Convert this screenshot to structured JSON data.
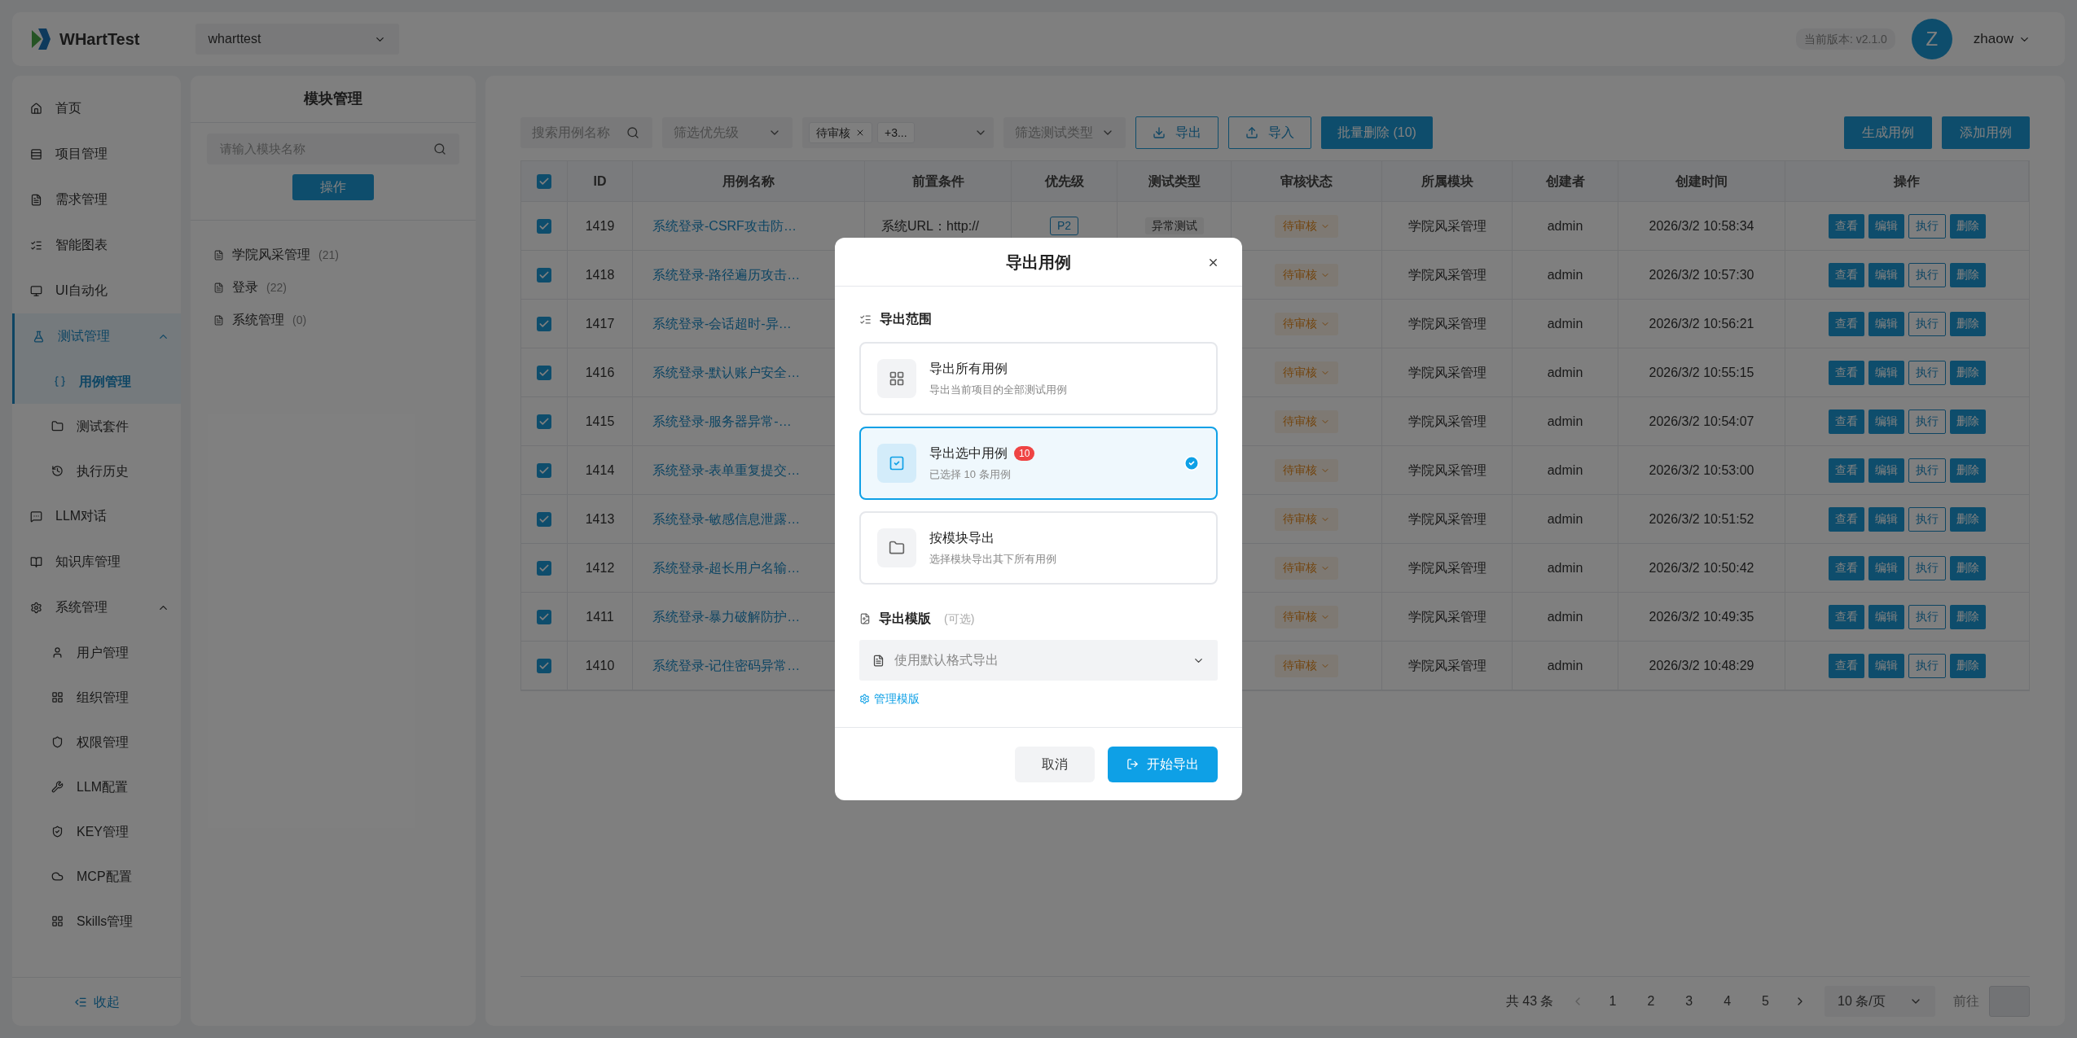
{
  "header": {
    "logo_text": "WHartTest",
    "project": "wharttest",
    "version": "当前版本: v2.1.0",
    "avatar_letter": "Z",
    "user": "zhaow"
  },
  "sidebar": {
    "items": [
      {
        "label": "首页",
        "selected": false
      },
      {
        "label": "项目管理",
        "selected": false
      },
      {
        "label": "需求管理",
        "selected": false
      },
      {
        "label": "智能图表",
        "selected": false
      },
      {
        "label": "UI自动化",
        "selected": false
      },
      {
        "label": "测试管理",
        "selected": true,
        "expanded": true,
        "children": [
          {
            "label": "用例管理",
            "selected": true
          },
          {
            "label": "测试套件",
            "selected": false
          },
          {
            "label": "执行历史",
            "selected": false
          }
        ]
      },
      {
        "label": "LLM对话",
        "selected": false
      },
      {
        "label": "知识库管理",
        "selected": false
      },
      {
        "label": "系统管理",
        "selected": false,
        "expanded": true,
        "children": [
          {
            "label": "用户管理",
            "selected": false
          },
          {
            "label": "组织管理",
            "selected": false
          },
          {
            "label": "权限管理",
            "selected": false
          },
          {
            "label": "LLM配置",
            "selected": false
          },
          {
            "label": "KEY管理",
            "selected": false
          },
          {
            "label": "MCP配置",
            "selected": false
          },
          {
            "label": "Skills管理",
            "selected": false
          }
        ]
      }
    ],
    "collapse_label": "收起"
  },
  "module_panel": {
    "title": "模块管理",
    "search_placeholder": "请输入模块名称",
    "action_button": "操作",
    "tree": [
      {
        "name": "学院风采管理",
        "count": "(21)"
      },
      {
        "name": "登录",
        "count": "(22)"
      },
      {
        "name": "系统管理",
        "count": "(0)"
      }
    ]
  },
  "toolbar": {
    "search_placeholder": "搜索用例名称",
    "priority_placeholder": "筛选优先级",
    "status_tags": [
      "待审核"
    ],
    "status_more": "+3...",
    "type_placeholder": "筛选测试类型",
    "buttons": [
      {
        "label": "导出",
        "kind": "download"
      },
      {
        "label": "导入",
        "kind": "upload"
      },
      {
        "label": "批量删除 (10)",
        "kind": "primary"
      }
    ],
    "right_buttons": [
      "生成用例",
      "添加用例"
    ]
  },
  "table": {
    "all_checked": true,
    "columns": [
      "ID",
      "用例名称",
      "前置条件",
      "优先级",
      "测试类型",
      "审核状态",
      "所属模块",
      "创建者",
      "创建时间",
      "操作"
    ],
    "rows": [
      {
        "checked": true,
        "id": "1419",
        "name": "系统登录-CSRF攻击防…",
        "precondition": "系统URL：http://",
        "priority": "P2",
        "test_type": "异常测试",
        "status": "待审核",
        "module": "学院风采管理",
        "creator": "admin",
        "created": "2026/3/2 10:58:34",
        "actions": [
          {
            "label": "查看",
            "kind": "solid"
          },
          {
            "label": "编辑",
            "kind": "solid"
          },
          {
            "label": "执行",
            "kind": "outline"
          },
          {
            "label": "删除",
            "kind": "solid"
          }
        ]
      },
      {
        "checked": true,
        "id": "1418",
        "name": "系统登录-路径遍历攻击…",
        "status": "待审核",
        "module": "学院风采管理",
        "creator": "admin",
        "created": "2026/3/2 10:57:30",
        "actions": [
          {
            "label": "查看",
            "kind": "solid"
          },
          {
            "label": "编辑",
            "kind": "solid"
          },
          {
            "label": "执行",
            "kind": "outline"
          },
          {
            "label": "删除",
            "kind": "solid"
          }
        ]
      },
      {
        "checked": true,
        "id": "1417",
        "name": "系统登录-会话超时-异…",
        "status": "待审核",
        "module": "学院风采管理",
        "creator": "admin",
        "created": "2026/3/2 10:56:21",
        "actions": [
          {
            "label": "查看",
            "kind": "solid"
          },
          {
            "label": "编辑",
            "kind": "solid"
          },
          {
            "label": "执行",
            "kind": "outline"
          },
          {
            "label": "删除",
            "kind": "solid"
          }
        ]
      },
      {
        "checked": true,
        "id": "1416",
        "name": "系统登录-默认账户安全…",
        "status": "待审核",
        "module": "学院风采管理",
        "creator": "admin",
        "created": "2026/3/2 10:55:15",
        "actions": [
          {
            "label": "查看",
            "kind": "solid"
          },
          {
            "label": "编辑",
            "kind": "solid"
          },
          {
            "label": "执行",
            "kind": "outline"
          },
          {
            "label": "删除",
            "kind": "solid"
          }
        ]
      },
      {
        "checked": true,
        "id": "1415",
        "name": "系统登录-服务器异常-…",
        "status": "待审核",
        "module": "学院风采管理",
        "creator": "admin",
        "created": "2026/3/2 10:54:07",
        "actions": [
          {
            "label": "查看",
            "kind": "solid"
          },
          {
            "label": "编辑",
            "kind": "solid"
          },
          {
            "label": "执行",
            "kind": "outline"
          },
          {
            "label": "删除",
            "kind": "solid"
          }
        ]
      },
      {
        "checked": true,
        "id": "1414",
        "name": "系统登录-表单重复提交…",
        "status": "待审核",
        "module": "学院风采管理",
        "creator": "admin",
        "created": "2026/3/2 10:53:00",
        "actions": [
          {
            "label": "查看",
            "kind": "solid"
          },
          {
            "label": "编辑",
            "kind": "solid"
          },
          {
            "label": "执行",
            "kind": "outline"
          },
          {
            "label": "删除",
            "kind": "solid"
          }
        ]
      },
      {
        "checked": true,
        "id": "1413",
        "name": "系统登录-敏感信息泄露…",
        "status": "待审核",
        "module": "学院风采管理",
        "creator": "admin",
        "created": "2026/3/2 10:51:52",
        "actions": [
          {
            "label": "查看",
            "kind": "solid"
          },
          {
            "label": "编辑",
            "kind": "solid"
          },
          {
            "label": "执行",
            "kind": "outline"
          },
          {
            "label": "删除",
            "kind": "solid"
          }
        ]
      },
      {
        "checked": true,
        "id": "1412",
        "name": "系统登录-超长用户名输…",
        "status": "待审核",
        "module": "学院风采管理",
        "creator": "admin",
        "created": "2026/3/2 10:50:42",
        "actions": [
          {
            "label": "查看",
            "kind": "solid"
          },
          {
            "label": "编辑",
            "kind": "solid"
          },
          {
            "label": "执行",
            "kind": "outline"
          },
          {
            "label": "删除",
            "kind": "solid"
          }
        ]
      },
      {
        "checked": true,
        "id": "1411",
        "name": "系统登录-暴力破解防护…",
        "status": "待审核",
        "module": "学院风采管理",
        "creator": "admin",
        "created": "2026/3/2 10:49:35",
        "actions": [
          {
            "label": "查看",
            "kind": "solid"
          },
          {
            "label": "编辑",
            "kind": "solid"
          },
          {
            "label": "执行",
            "kind": "outline"
          },
          {
            "label": "删除",
            "kind": "solid"
          }
        ]
      },
      {
        "checked": true,
        "id": "1410",
        "name": "系统登录-记住密码异常…",
        "status": "待审核",
        "module": "学院风采管理",
        "creator": "admin",
        "created": "2026/3/2 10:48:29",
        "actions": [
          {
            "label": "查看",
            "kind": "solid"
          },
          {
            "label": "编辑",
            "kind": "solid"
          },
          {
            "label": "执行",
            "kind": "outline"
          },
          {
            "label": "删除",
            "kind": "solid"
          }
        ]
      }
    ]
  },
  "pagination": {
    "total": "共 43 条",
    "pages": [
      "1",
      "2",
      "3",
      "4",
      "5"
    ],
    "page_size": "10 条/页",
    "goto_label": "前往"
  },
  "dialog": {
    "title": "导出用例",
    "scope_title": "导出范围",
    "options": [
      {
        "title": "导出所有用例",
        "description": "导出当前项目的全部测试用例",
        "selected": false
      },
      {
        "title": "导出选中用例",
        "badge": "10",
        "description": "已选择 10 条用例",
        "selected": true
      },
      {
        "title": "按模块导出",
        "description": "选择模块导出其下所有用例",
        "selected": false
      }
    ],
    "template_title": "导出模版",
    "template_hint": "(可选)",
    "template_placeholder": "使用默认格式导出",
    "manage_link": "管理模版",
    "cancel": "取消",
    "confirm": "开始导出"
  }
}
